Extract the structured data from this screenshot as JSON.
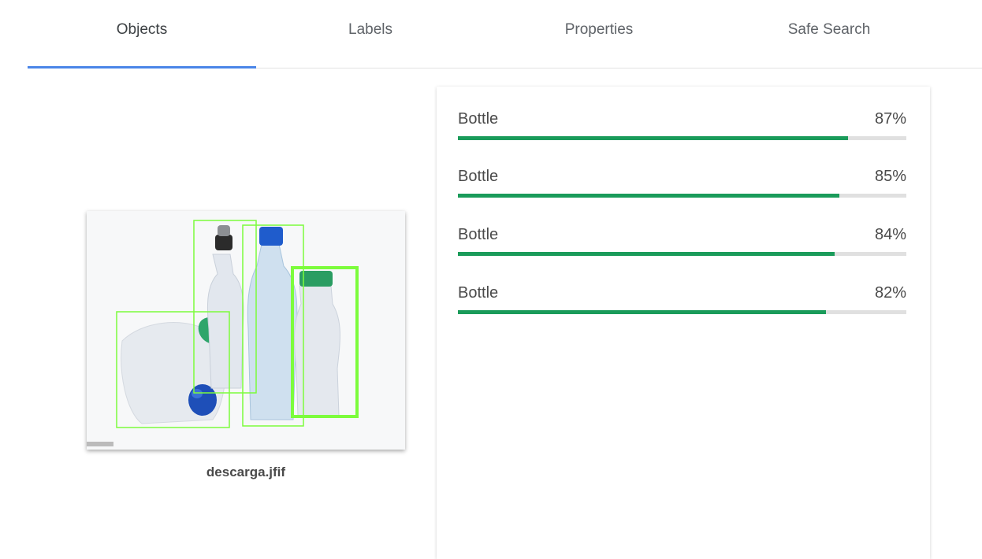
{
  "tabs": [
    {
      "label": "Objects",
      "active": true
    },
    {
      "label": "Labels",
      "active": false
    },
    {
      "label": "Properties",
      "active": false
    },
    {
      "label": "Safe Search",
      "active": false
    }
  ],
  "image": {
    "filename": "descarga.jfif"
  },
  "results": [
    {
      "label": "Bottle",
      "score": "87%",
      "fraction": 0.87
    },
    {
      "label": "Bottle",
      "score": "85%",
      "fraction": 0.85
    },
    {
      "label": "Bottle",
      "score": "84%",
      "fraction": 0.84
    },
    {
      "label": "Bottle",
      "score": "82%",
      "fraction": 0.82
    }
  ],
  "colors": {
    "tab_indicator": "#4a86e8",
    "score_bar": "#1a9b5a",
    "bounding_box": "#7cfc3c"
  }
}
